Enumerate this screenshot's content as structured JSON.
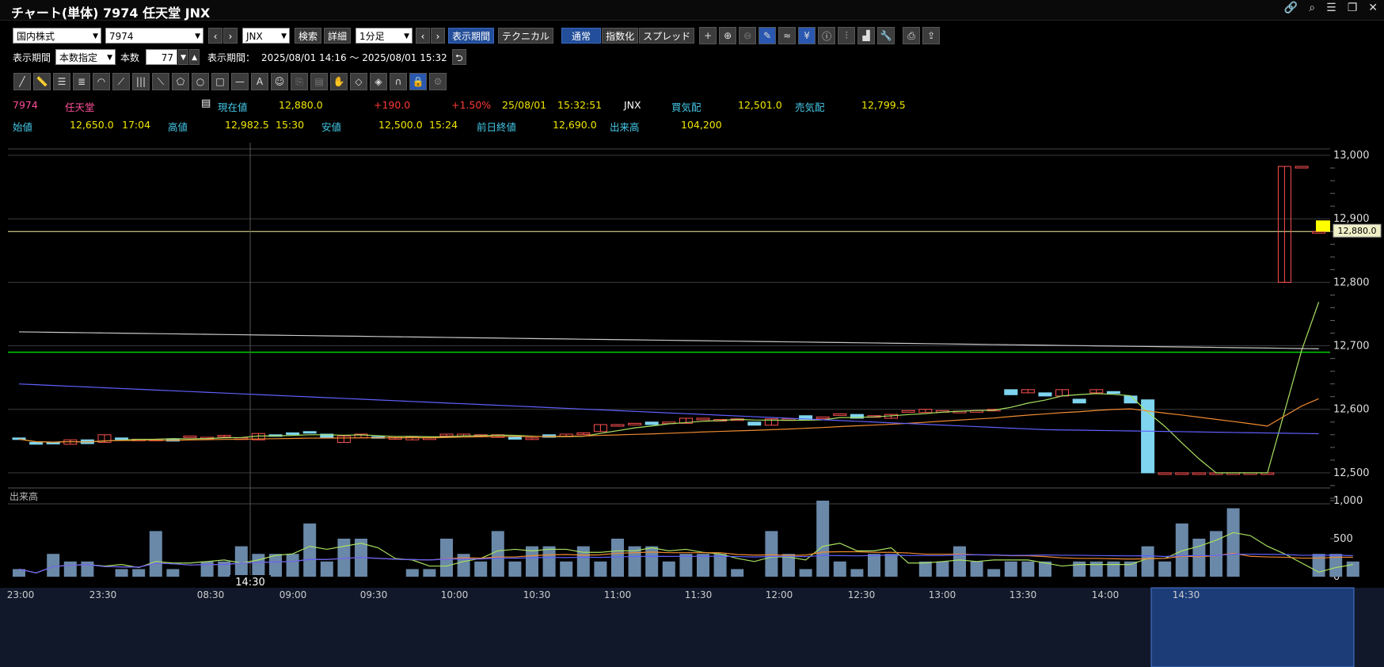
{
  "window": {
    "title": "チャート(単体) 7974 任天堂 JNX"
  },
  "toolbar1": {
    "market": "国内株式",
    "code": "7974",
    "exchange": "JNX",
    "search_label": "検索",
    "detail_label": "詳細",
    "interval": "1分足",
    "period_btn": "表示期間",
    "technical_btn": "テクニカル",
    "normal_btn": "通常",
    "index_btn": "指数化",
    "spread_btn": "スプレッド"
  },
  "toolbar2": {
    "period_label": "表示期間",
    "count_mode": "本数指定",
    "count_label": "本数",
    "count_value": "77",
    "range_label": "表示期間：",
    "range_value": "2025/08/01 14:16 ～ 2025/08/01 15:32"
  },
  "quote": {
    "code": "7974",
    "name": "任天堂",
    "current_label": "現在値",
    "current": "12,880.0",
    "change": "+190.0",
    "change_pct": "+1.50%",
    "date": "25/08/01",
    "time": "15:32:51",
    "exchange": "JNX",
    "bid_label": "買気配",
    "bid": "12,501.0",
    "ask_label": "売気配",
    "ask": "12,799.5",
    "open_label": "始値",
    "open": "12,650.0",
    "open_time": "17:04",
    "high_label": "高値",
    "high": "12,982.5",
    "high_time": "15:30",
    "low_label": "安値",
    "low": "12,500.0",
    "low_time": "15:24",
    "prev_close_label": "前日終値",
    "prev_close": "12,690.0",
    "volume_label": "出来高",
    "volume": "104,200"
  },
  "cursor_time_label": "14:30",
  "price_marker": "12,880.0",
  "volume_panel_label": "出来高",
  "colors": {
    "up": "#ff5050",
    "down": "#7fd4f0",
    "ma_short": "#a8e060",
    "ma_mid": "#f08a30",
    "ma_long": "#6060ff",
    "ma_xlong": "#c8c8c8",
    "prev_close_line": "#00d000",
    "current_line": "#f0f0a0",
    "volume_bar": "#6a88a8"
  },
  "chart_data": [
    {
      "type": "candlestick",
      "ylim": [
        12450,
        13020
      ],
      "yticks": [
        "12,500",
        "12,600",
        "12,700",
        "12,800",
        "12,900",
        "13,000"
      ],
      "xticks": [
        "23:00",
        "23:30",
        "08:30",
        "09:00",
        "09:30",
        "10:00",
        "10:30",
        "11:00",
        "11:30",
        "12:00",
        "12:30",
        "13:00",
        "13:30",
        "14:00",
        "14:30"
      ],
      "prev_close": 12690,
      "current": 12880,
      "candles": [
        [
          12555,
          12555,
          12553,
          12553
        ],
        [
          12548,
          12548,
          12545,
          12545
        ],
        [
          12548,
          12548,
          12547,
          12547
        ],
        [
          12545,
          12552,
          12545,
          12552
        ],
        [
          12552,
          12552,
          12546,
          12546
        ],
        [
          12548,
          12560,
          12548,
          12560
        ],
        [
          12555,
          12555,
          12553,
          12553
        ],
        [
          12553,
          12553,
          12553,
          12553
        ],
        [
          12553,
          12553,
          12553,
          12553
        ],
        [
          12553,
          12553,
          12550,
          12550
        ],
        [
          12558,
          12558,
          12558,
          12558
        ],
        [
          12556,
          12556,
          12556,
          12556
        ],
        [
          12557,
          12559,
          12557,
          12559
        ],
        [
          12555,
          12555,
          12555,
          12555
        ],
        [
          12552,
          12562,
          12552,
          12562
        ],
        [
          12560,
          12560,
          12558,
          12558
        ],
        [
          12563,
          12563,
          12561,
          12561
        ],
        [
          12565,
          12565,
          12564,
          12564
        ],
        [
          12561,
          12561,
          12555,
          12555
        ],
        [
          12548,
          12558,
          12548,
          12558
        ],
        [
          12555,
          12561,
          12555,
          12561
        ],
        [
          12557,
          12557,
          12555,
          12555
        ],
        [
          12553,
          12557,
          12553,
          12557
        ],
        [
          12552,
          12556,
          12552,
          12556
        ],
        [
          12555,
          12555,
          12555,
          12555
        ],
        [
          12558,
          12561,
          12558,
          12561
        ],
        [
          12558,
          12561,
          12558,
          12561
        ],
        [
          12558,
          12560,
          12558,
          12560
        ],
        [
          12556,
          12560,
          12556,
          12560
        ],
        [
          12557,
          12557,
          12553,
          12553
        ],
        [
          12553,
          12555,
          12553,
          12555
        ],
        [
          12560,
          12560,
          12556,
          12556
        ],
        [
          12557,
          12561,
          12557,
          12561
        ],
        [
          12561,
          12563,
          12561,
          12563
        ],
        [
          12565,
          12576,
          12565,
          12576
        ],
        [
          12575,
          12576,
          12575,
          12576
        ],
        [
          12578,
          12578,
          12578,
          12578
        ],
        [
          12580,
          12580,
          12576,
          12576
        ],
        [
          12580,
          12580,
          12580,
          12580
        ],
        [
          12578,
          12586,
          12578,
          12586
        ],
        [
          12586,
          12586,
          12586,
          12586
        ],
        [
          12584,
          12584,
          12584,
          12584
        ],
        [
          12584,
          12585,
          12584,
          12585
        ],
        [
          12580,
          12580,
          12575,
          12575
        ],
        [
          12575,
          12585,
          12575,
          12585
        ],
        [
          12585,
          12585,
          12585,
          12585
        ],
        [
          12590,
          12590,
          12584,
          12584
        ],
        [
          12588,
          12588,
          12588,
          12588
        ],
        [
          12593,
          12593,
          12593,
          12593
        ],
        [
          12592,
          12592,
          12586,
          12586
        ],
        [
          12590,
          12590,
          12590,
          12590
        ],
        [
          12586,
          12592,
          12586,
          12592
        ],
        [
          12598,
          12598,
          12598,
          12598
        ],
        [
          12595,
          12600,
          12595,
          12600
        ],
        [
          12598,
          12598,
          12598,
          12598
        ],
        [
          12597,
          12597,
          12597,
          12597
        ],
        [
          12598,
          12598,
          12598,
          12598
        ],
        [
          12599,
          12600,
          12599,
          12600
        ],
        [
          12631,
          12631,
          12623,
          12623
        ],
        [
          12626,
          12631,
          12626,
          12631
        ],
        [
          12626,
          12626,
          12621,
          12621
        ],
        [
          12621,
          12631,
          12621,
          12631
        ],
        [
          12616,
          12616,
          12610,
          12610
        ],
        [
          12626,
          12631,
          12626,
          12631
        ],
        [
          12628,
          12628,
          12625,
          12625
        ],
        [
          12621,
          12621,
          12610,
          12610
        ],
        [
          12615,
          12615,
          12500,
          12500
        ],
        [
          12500,
          12500,
          12500,
          12500
        ],
        [
          12500,
          12500,
          12500,
          12500
        ],
        [
          12500,
          12500,
          12500,
          12500
        ],
        [
          12500,
          12500,
          12500,
          12500
        ],
        [
          12500,
          12500,
          12500,
          12500
        ],
        [
          12500,
          12500,
          12500,
          12500
        ],
        [
          12500,
          12500,
          12500,
          12500
        ],
        [
          12800,
          12982.5,
          12800,
          12982.5
        ],
        [
          12982.5,
          12982.5,
          12982.5,
          12982.5
        ],
        [
          12880,
          12880,
          12880,
          12880
        ]
      ],
      "visible_candles": 77
    },
    {
      "type": "bar",
      "title": "出来高",
      "ylim": [
        0,
        1000
      ],
      "yticks": [
        "0",
        "500",
        "1,000"
      ],
      "values": [
        100,
        0,
        300,
        200,
        200,
        0,
        100,
        100,
        600,
        100,
        0,
        200,
        200,
        400,
        300,
        300,
        300,
        700,
        200,
        500,
        500,
        0,
        0,
        100,
        100,
        500,
        300,
        200,
        600,
        200,
        400,
        400,
        200,
        400,
        200,
        500,
        400,
        400,
        200,
        300,
        300,
        300,
        100,
        0,
        600,
        300,
        100,
        1000,
        200,
        100,
        300,
        300,
        0,
        200,
        200,
        400,
        200,
        100,
        200,
        200,
        200,
        0,
        200,
        200,
        200,
        200,
        400,
        200,
        700,
        500,
        600,
        900,
        0,
        0,
        0,
        0,
        300,
        300,
        200
      ]
    }
  ]
}
